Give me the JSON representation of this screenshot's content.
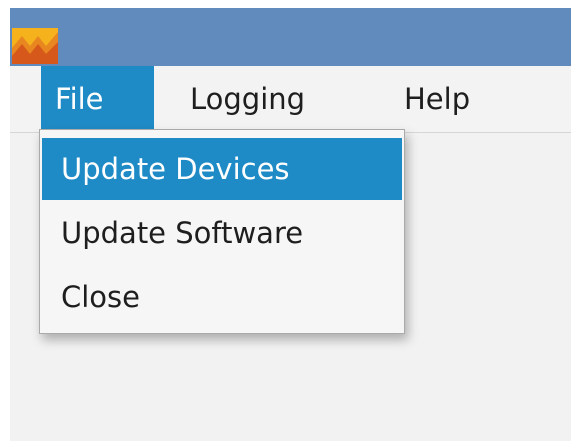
{
  "menubar": {
    "items": [
      {
        "label": "File",
        "active": true
      },
      {
        "label": "Logging",
        "active": false
      },
      {
        "label": "Help",
        "active": false
      }
    ]
  },
  "file_menu": {
    "items": [
      {
        "label": "Update Devices",
        "highlighted": true
      },
      {
        "label": "Update Software",
        "highlighted": false
      },
      {
        "label": "Close",
        "highlighted": false
      }
    ]
  },
  "colors": {
    "titlebar": "#628bbd",
    "highlight": "#1f8bc6",
    "window_background": "#f2f2f2"
  },
  "icons": {
    "app": "app-logo-icon"
  }
}
